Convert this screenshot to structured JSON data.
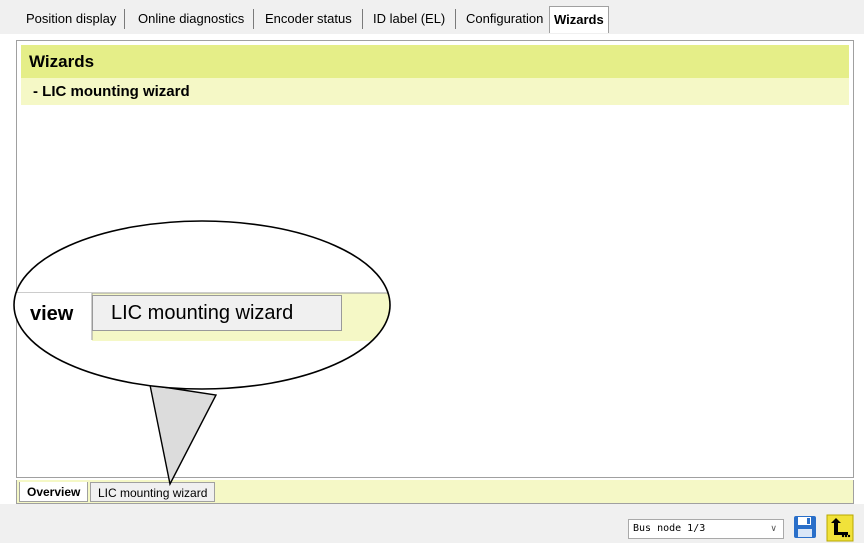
{
  "tabs": [
    {
      "label": "Position display",
      "active": false
    },
    {
      "label": "Online diagnostics",
      "active": false
    },
    {
      "label": "Encoder status",
      "active": false
    },
    {
      "label": "ID label (EL)",
      "active": false
    },
    {
      "label": "Configuration",
      "active": false
    },
    {
      "label": "Wizards",
      "active": true
    }
  ],
  "panel": {
    "title": "Wizards",
    "subtitle": "- LIC mounting wizard"
  },
  "subtabs": [
    {
      "label": "Overview",
      "active": true
    },
    {
      "label": "LIC mounting wizard",
      "active": false
    }
  ],
  "magnifier": {
    "partial_text": "view",
    "tab_label": "LIC mounting wizard"
  },
  "statusbar": {
    "bus_node": "Bus node 1/3",
    "save_icon": "floppy-disk-icon",
    "export_icon": "export-arrow-icon"
  },
  "colors": {
    "header_bg": "#e5ee88",
    "subheader_bg": "#f5f8c6",
    "icon_blue": "#2a6fc9",
    "icon_yellow": "#f1e23a"
  }
}
